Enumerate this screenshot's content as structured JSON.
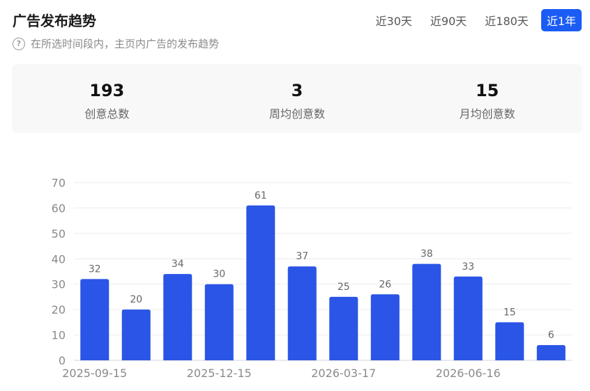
{
  "header": {
    "title": "广告发布趋势",
    "subtitle": "在所选时间段内，主页内广告的发布趋势",
    "range_tabs": [
      {
        "label": "近30天",
        "active": false
      },
      {
        "label": "近90天",
        "active": false
      },
      {
        "label": "近180天",
        "active": false
      },
      {
        "label": "近1年",
        "active": true
      }
    ]
  },
  "stats": [
    {
      "value": "193",
      "label": "创意总数"
    },
    {
      "value": "3",
      "label": "周均创意数"
    },
    {
      "value": "15",
      "label": "月均创意数"
    }
  ],
  "colors": {
    "accent": "#1b5cf5",
    "bar": "#2b55e6"
  },
  "chart_data": {
    "type": "bar",
    "values": [
      32,
      20,
      34,
      30,
      61,
      37,
      25,
      26,
      38,
      33,
      15,
      6
    ],
    "x_tick_labels": [
      {
        "index": 0,
        "label": "2025-09-15"
      },
      {
        "index": 3,
        "label": "2025-12-15"
      },
      {
        "index": 6,
        "label": "2026-03-17"
      },
      {
        "index": 9,
        "label": "2026-06-16"
      }
    ],
    "yticks": [
      0,
      10,
      20,
      30,
      40,
      50,
      60,
      70
    ],
    "ylim": [
      0,
      70
    ],
    "grid": true,
    "data_labels": true
  }
}
